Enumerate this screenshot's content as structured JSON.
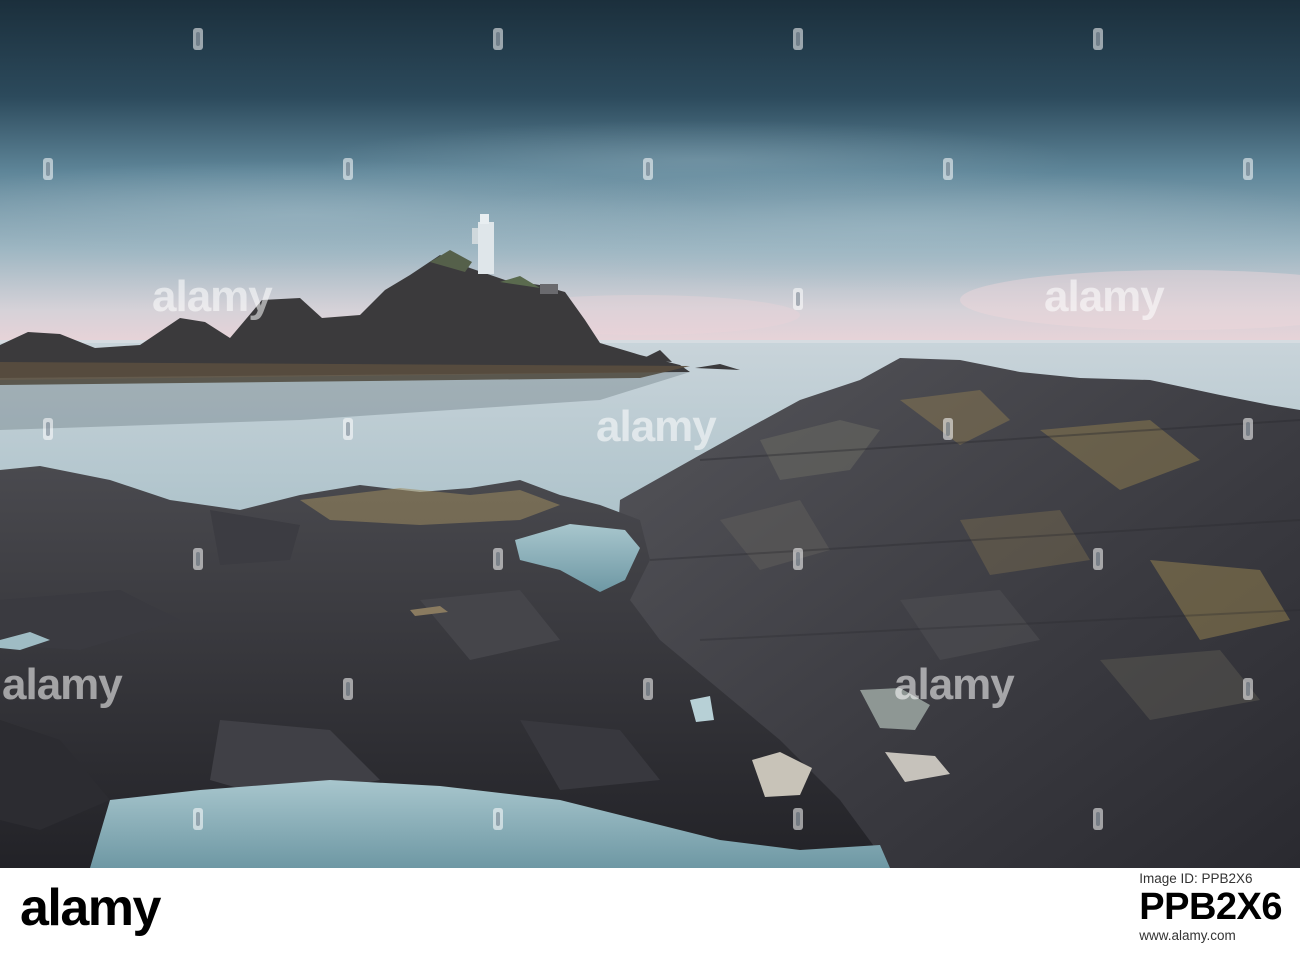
{
  "image": {
    "colors": {
      "sky_dark": "#1e3442",
      "sky_mid": "#6f95a8",
      "horizon_pink": "#e8cfd4",
      "sea": "#aac3cc",
      "rock_dark": "#2b2b31",
      "lichen": "#a78a4a"
    }
  },
  "watermark": {
    "brand": "alamy",
    "icon_name": "alamy-watermark-icon"
  },
  "footer": {
    "logo": "alamy",
    "caption": "Image ID: PPB2X6",
    "image_id": "PPB2X6",
    "url": "www.alamy.com"
  }
}
